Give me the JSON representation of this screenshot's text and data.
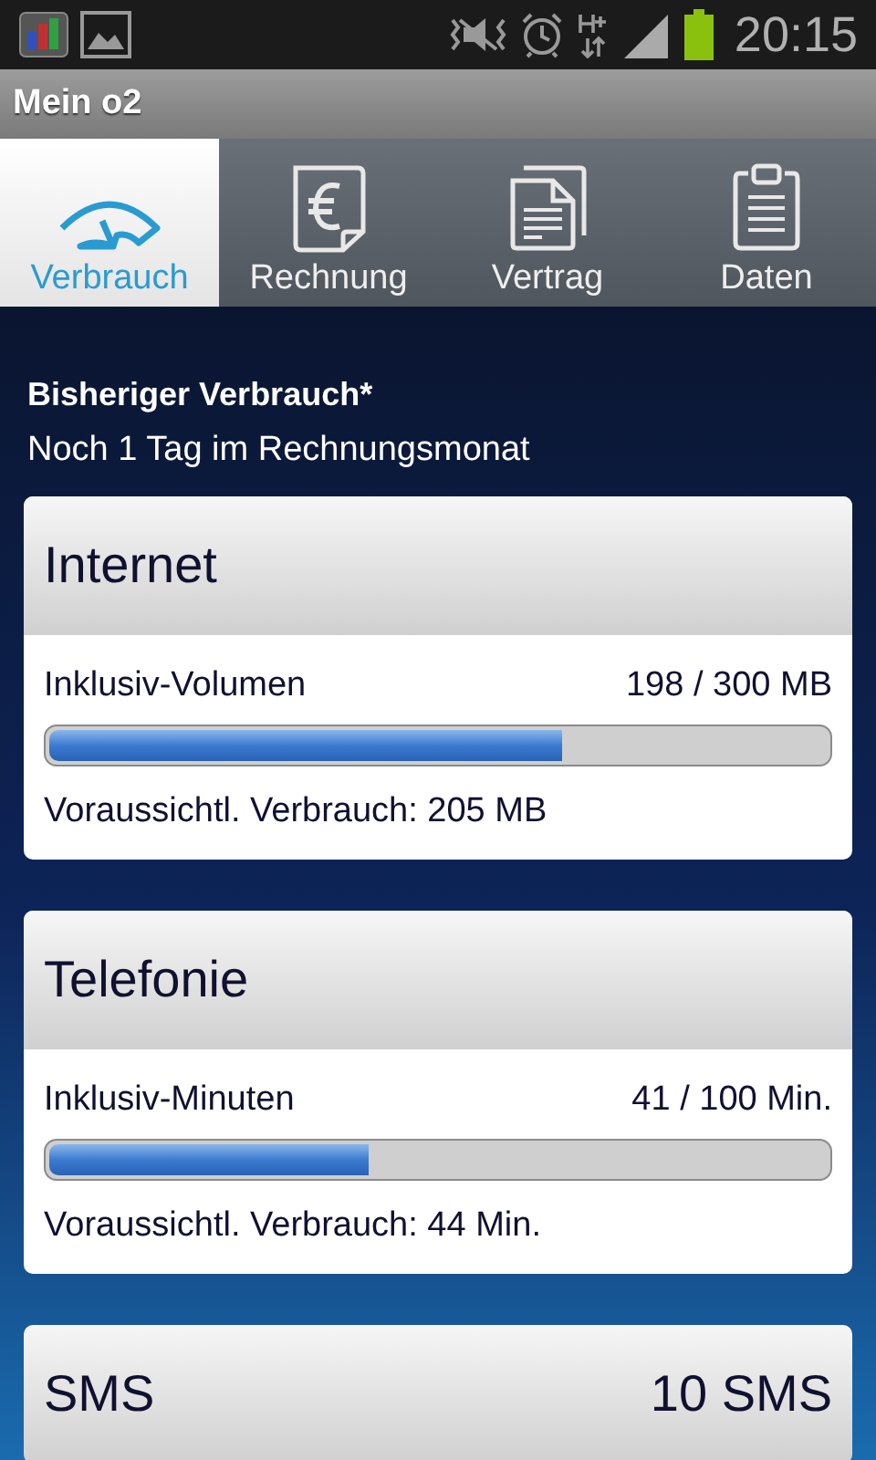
{
  "status_bar": {
    "time": "20:15"
  },
  "app_bar": {
    "title": "Mein o2"
  },
  "tabs": [
    {
      "label": "Verbrauch",
      "kind": "gauge",
      "selected": true
    },
    {
      "label": "Rechnung",
      "kind": "invoice",
      "selected": false
    },
    {
      "label": "Vertrag",
      "kind": "documents",
      "selected": false
    },
    {
      "label": "Daten",
      "kind": "clipboard",
      "selected": false
    }
  ],
  "heading": "Bisheriger Verbrauch*",
  "subheading": "Noch 1 Tag im Rechnungsmonat",
  "cards": [
    {
      "kind": "meter",
      "title": "Internet",
      "label": "Inklusiv-Volumen",
      "reading": "198 / 300 MB",
      "level": 0.66,
      "forecast": "Voraussichtl. Verbrauch: 205 MB"
    },
    {
      "kind": "meter",
      "title": "Telefonie",
      "label": "Inklusiv-Minuten",
      "reading": "41 / 100 Min.",
      "level": 0.41,
      "forecast": "Voraussichtl. Verbrauch: 44 Min."
    },
    {
      "kind": "summary",
      "title": "SMS",
      "reading": "10 SMS"
    }
  ]
}
